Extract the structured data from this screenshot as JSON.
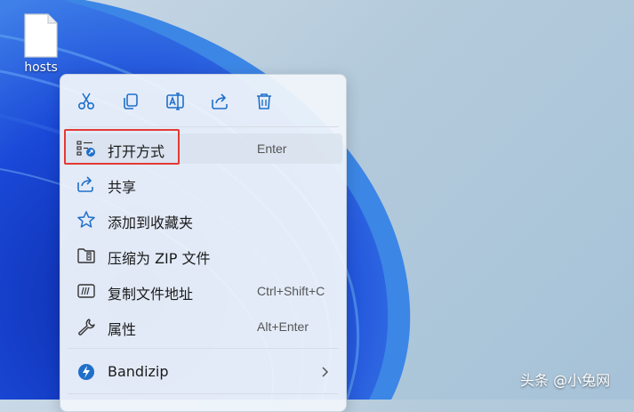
{
  "desktop": {
    "file_label": "hosts"
  },
  "toolbar": {
    "icons": [
      "scissors-icon",
      "copy-icon",
      "rename-icon",
      "share-icon",
      "trash-icon"
    ]
  },
  "menu": {
    "items": [
      {
        "label": "打开方式",
        "shortcut": "Enter",
        "icon": "open-with-icon"
      },
      {
        "label": "共享",
        "shortcut": "",
        "icon": "share-icon"
      },
      {
        "label": "添加到收藏夹",
        "shortcut": "",
        "icon": "star-icon"
      },
      {
        "label": "压缩为 ZIP 文件",
        "shortcut": "",
        "icon": "zip-folder-icon"
      },
      {
        "label": "复制文件地址",
        "shortcut": "Ctrl+Shift+C",
        "icon": "copy-path-icon"
      },
      {
        "label": "属性",
        "shortcut": "Alt+Enter",
        "icon": "wrench-icon"
      },
      {
        "label": "Bandizip",
        "shortcut": "",
        "icon": "bandizip-icon"
      }
    ]
  },
  "watermark": {
    "text": "头条 @小兔网"
  },
  "colors": {
    "accent": "#1f6fc9",
    "highlight": "#e53935",
    "wallpaper_blue": "#1746d6"
  }
}
